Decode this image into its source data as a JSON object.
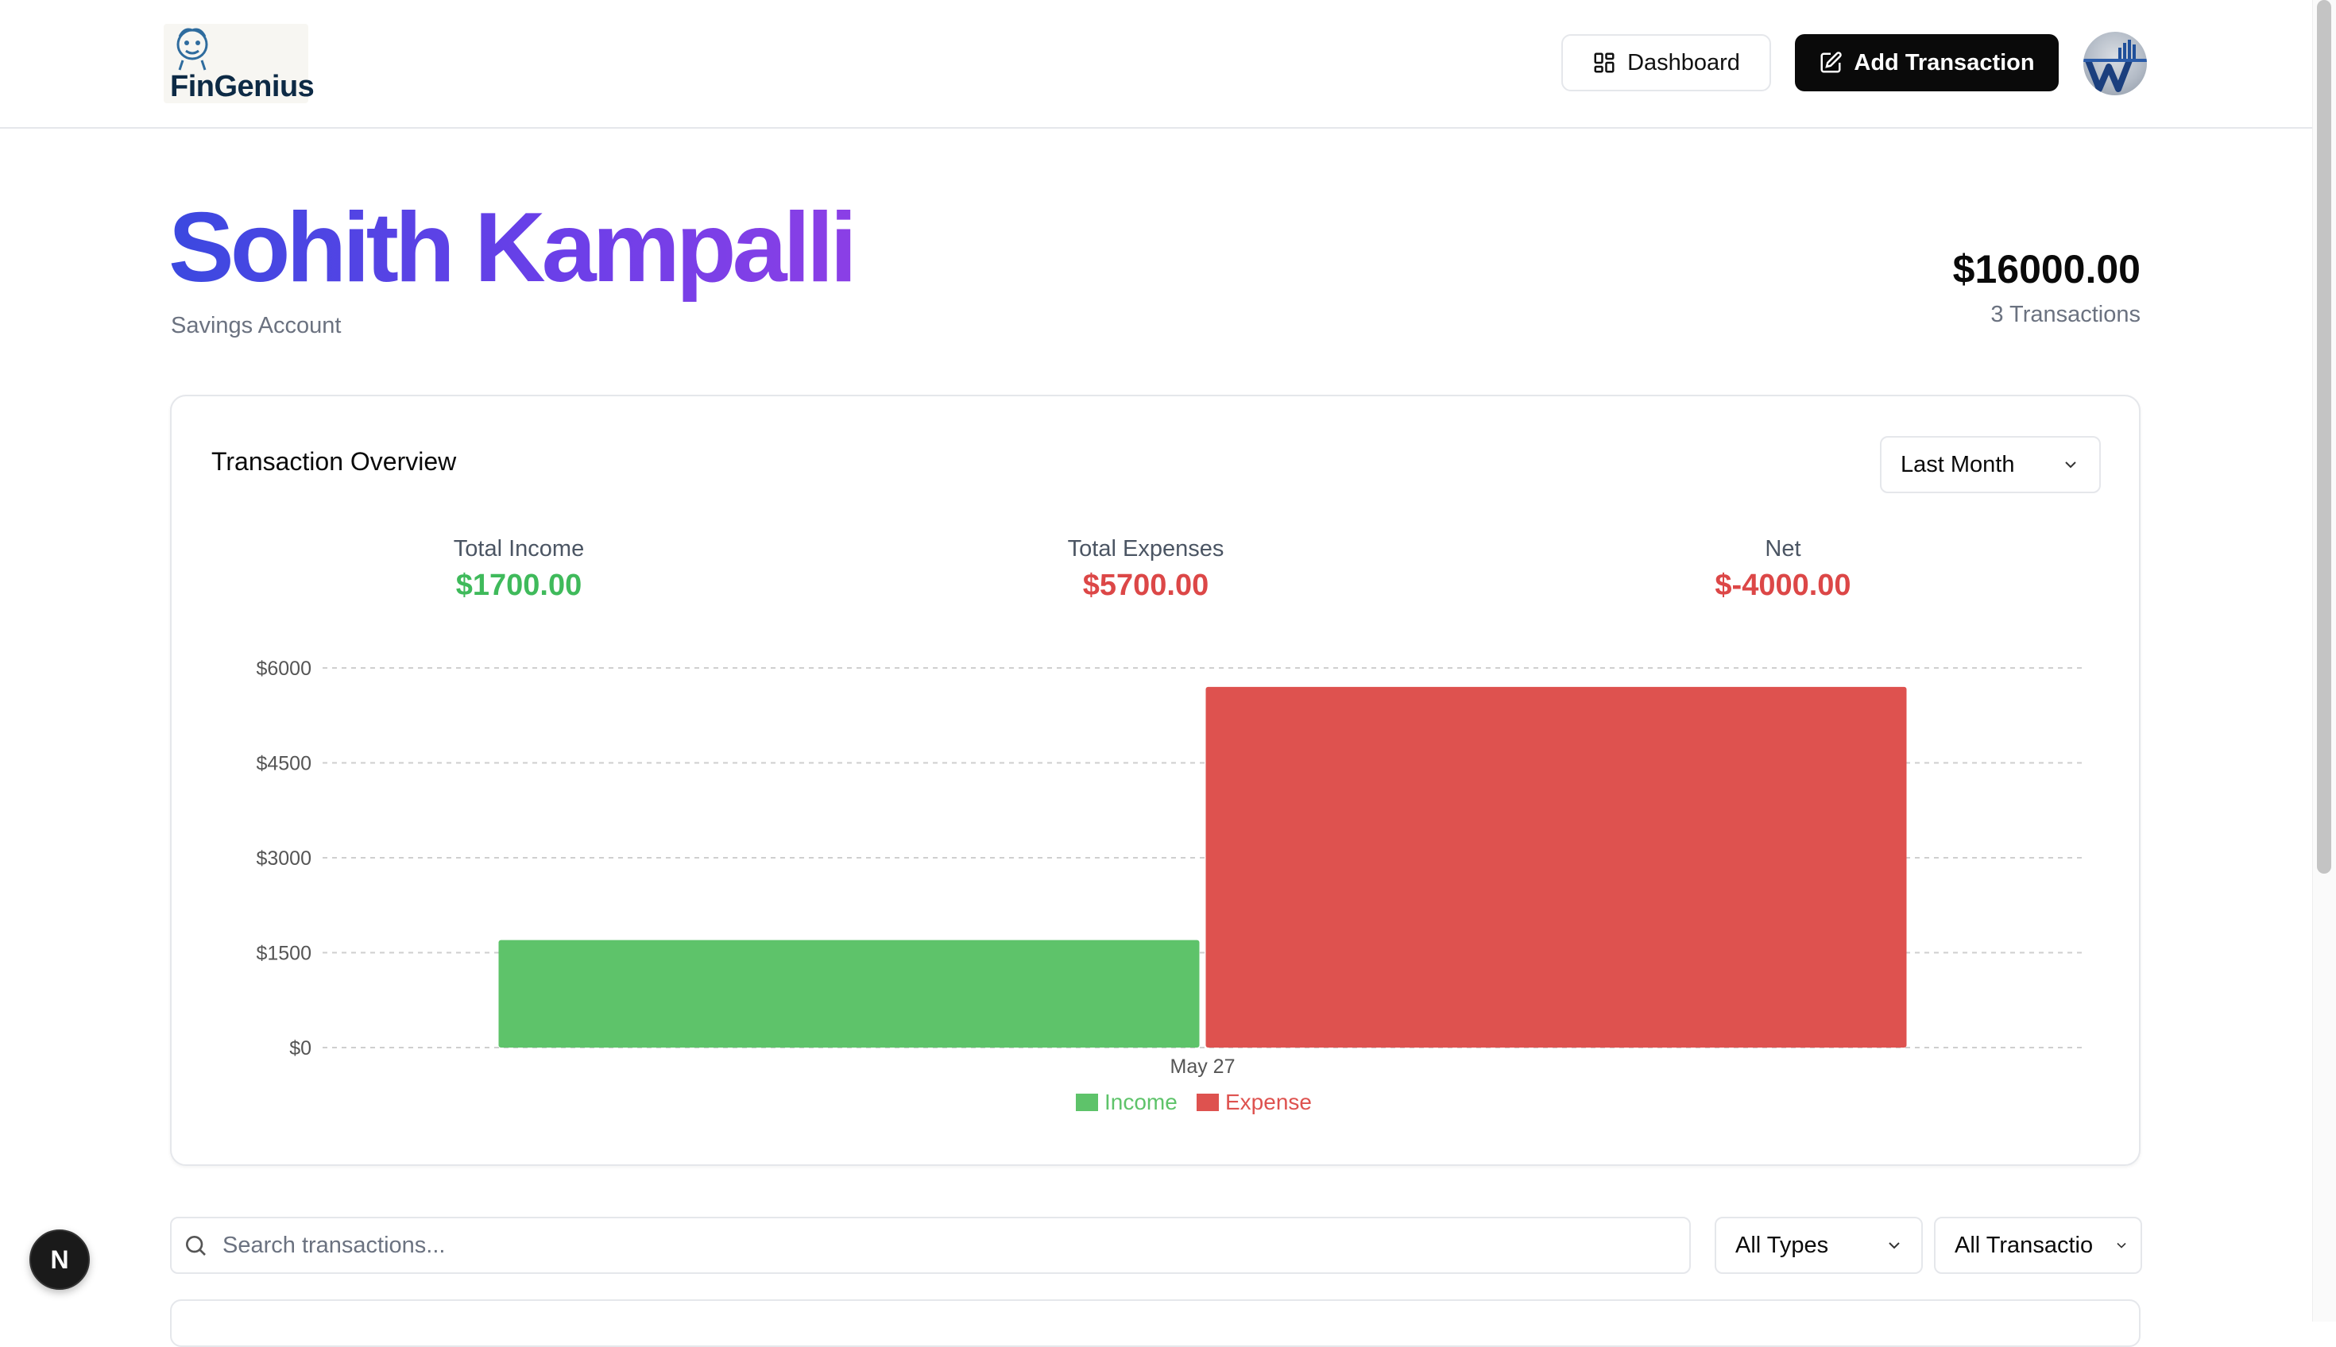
{
  "header": {
    "logo_text": "FinGenius",
    "dashboard_label": "Dashboard",
    "add_transaction_label": "Add Transaction"
  },
  "account": {
    "name": "Sohith Kampalli",
    "type": "Savings Account",
    "balance": "$16000.00",
    "transaction_count": "3 Transactions"
  },
  "overview": {
    "title": "Transaction Overview",
    "period": "Last Month",
    "stats": {
      "income_label": "Total Income",
      "income_value": "$1700.00",
      "expenses_label": "Total Expenses",
      "expenses_value": "$5700.00",
      "net_label": "Net",
      "net_value": "$-4000.00"
    }
  },
  "chart_data": {
    "type": "bar",
    "categories": [
      "May 27"
    ],
    "series": [
      {
        "name": "Income",
        "values": [
          1700
        ],
        "color": "#5ec36a"
      },
      {
        "name": "Expense",
        "values": [
          5700
        ],
        "color": "#de524f"
      }
    ],
    "ylim": [
      0,
      6000
    ],
    "yticks": [
      0,
      1500,
      3000,
      4500,
      6000
    ],
    "ytick_labels": [
      "$0",
      "$1500",
      "$3000",
      "$4500",
      "$6000"
    ],
    "grid": true,
    "legend": "bottom"
  },
  "filters": {
    "search_placeholder": "Search transactions...",
    "type_filter": "All Types",
    "transaction_filter": "All Transactio"
  },
  "badge": {
    "label": "N"
  }
}
